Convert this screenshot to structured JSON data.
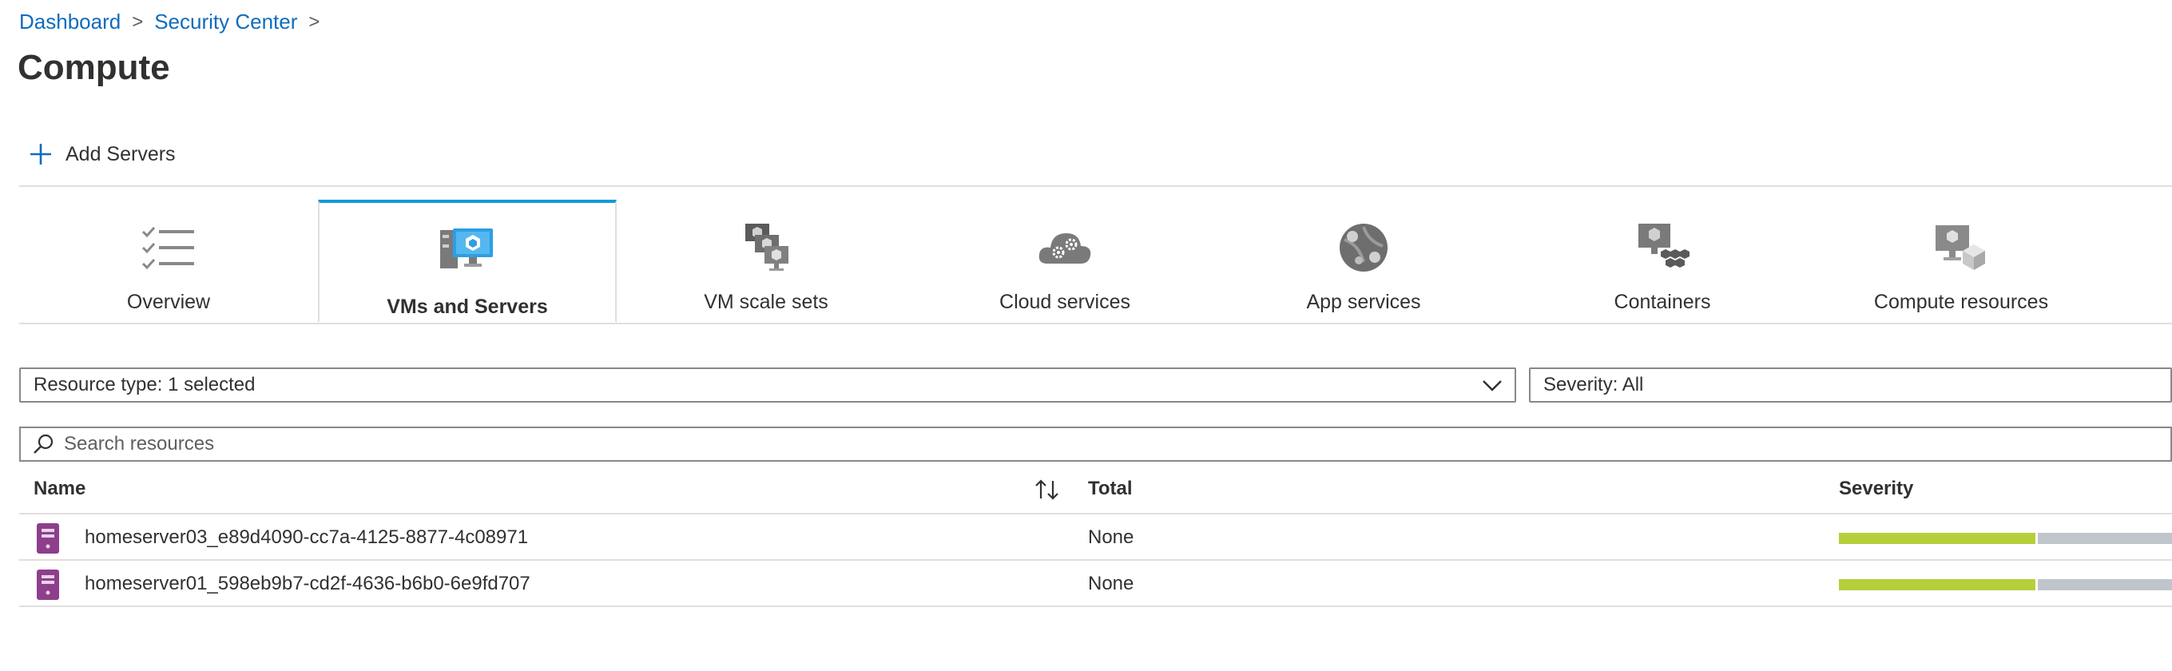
{
  "breadcrumb": {
    "items": [
      "Dashboard",
      "Security Center"
    ],
    "separator": ">"
  },
  "page": {
    "title": "Compute"
  },
  "toolbar": {
    "add_label": "Add Servers"
  },
  "tabs": [
    {
      "label": "Overview",
      "icon": "checklist-icon"
    },
    {
      "label": "VMs and Servers",
      "icon": "vm-server-icon",
      "active": true
    },
    {
      "label": "VM scale sets",
      "icon": "vm-scale-sets-icon"
    },
    {
      "label": "Cloud services",
      "icon": "cloud-services-icon"
    },
    {
      "label": "App services",
      "icon": "app-services-icon"
    },
    {
      "label": "Containers",
      "icon": "containers-icon"
    },
    {
      "label": "Compute resources",
      "icon": "compute-resources-icon"
    }
  ],
  "filters": {
    "resource_type": "Resource type: 1 selected",
    "severity": "Severity: All"
  },
  "search": {
    "placeholder": "Search resources"
  },
  "table": {
    "columns": [
      "Name",
      "Total",
      "Severity"
    ],
    "rows": [
      {
        "name": "homeserver03_e89d4090-cc7a-4125-8877-4c08971",
        "total": "None",
        "severity_fraction": 0.55
      },
      {
        "name": "homeserver01_598eb9b7-cd2f-4636-b6b0-6e9fd707",
        "total": "None",
        "severity_fraction": 0.55
      }
    ]
  },
  "colors": {
    "link": "#0f6cbd",
    "active_tab_accent": "#0f9bd7",
    "severity_low": "#b5cf3b",
    "severity_none": "#c0c5cb",
    "server_icon": "#8d3f8b"
  }
}
